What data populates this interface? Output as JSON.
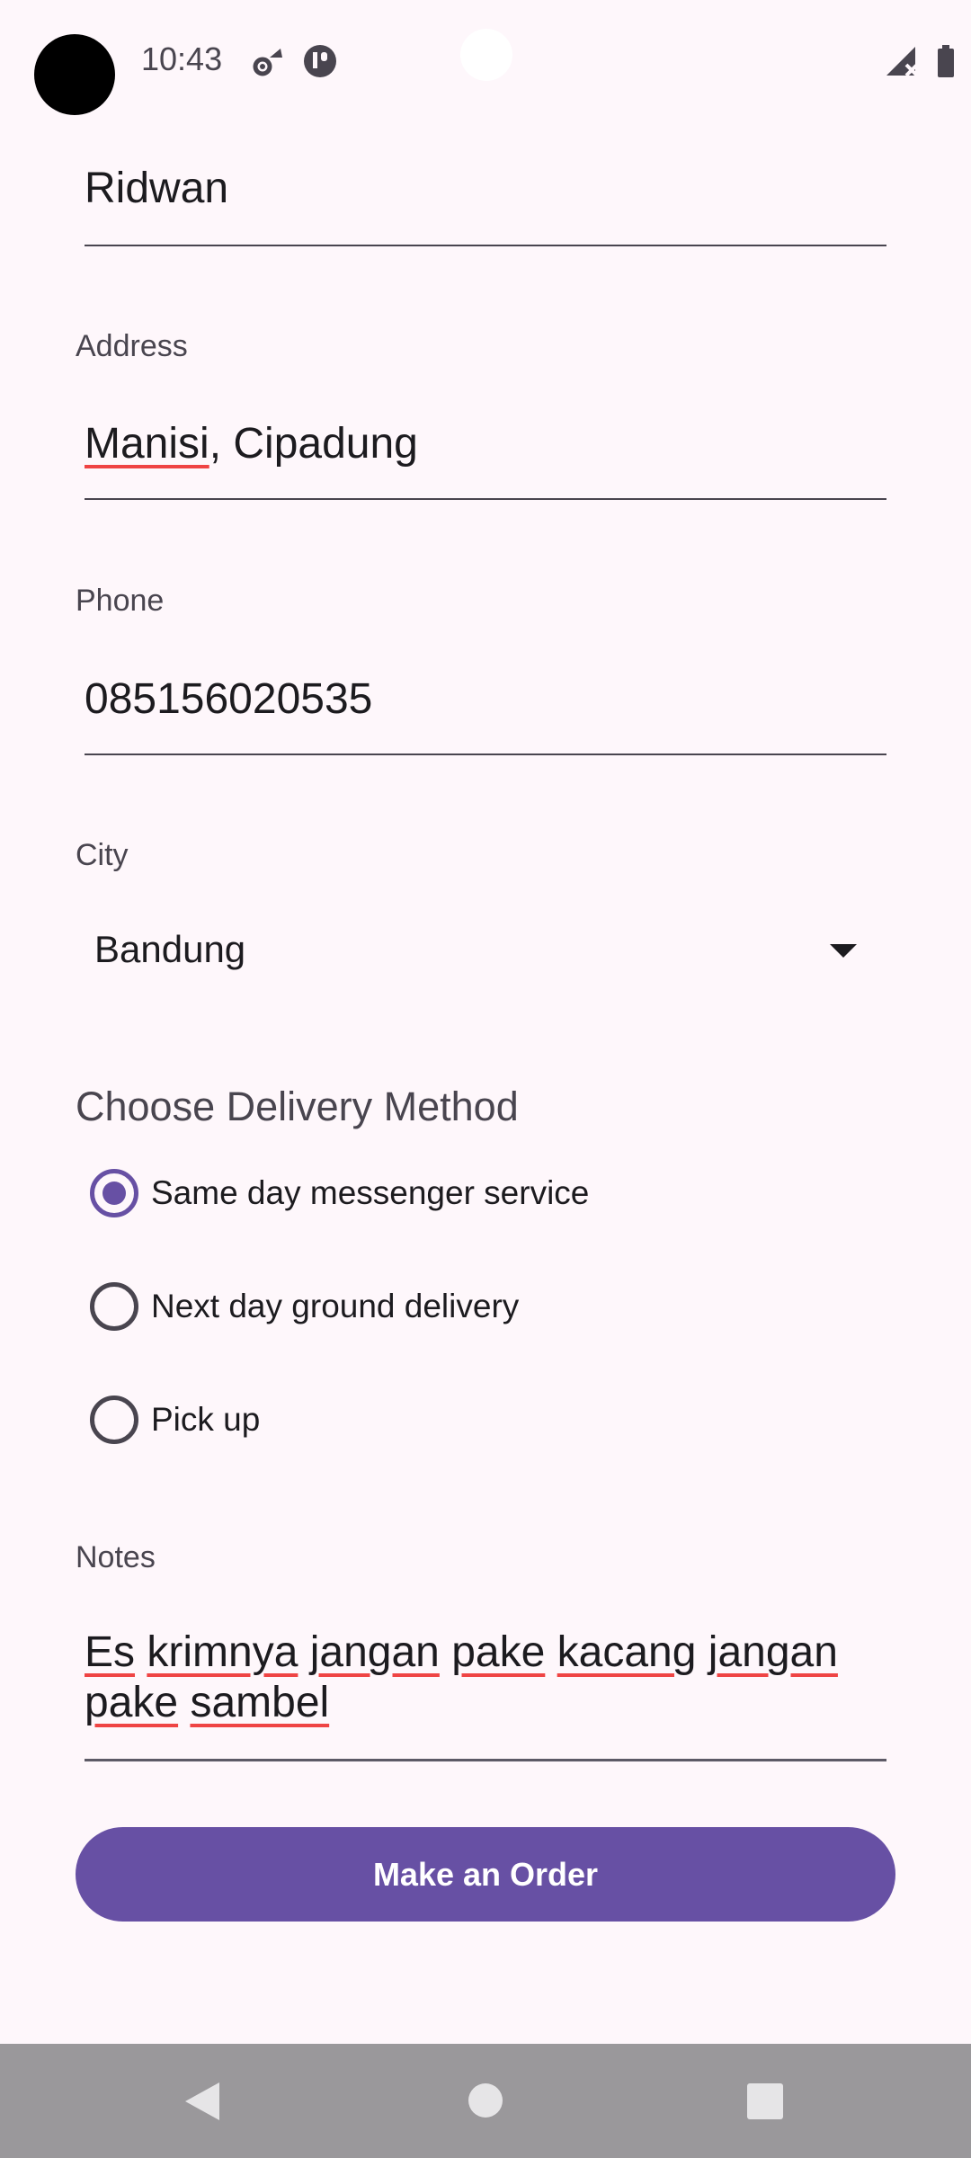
{
  "status_bar": {
    "time": "10:43",
    "icons": [
      "settings-wifi-icon",
      "app-notification-icon",
      "no-signal-icon",
      "battery-icon"
    ]
  },
  "form": {
    "name": {
      "value": "Ridwan"
    },
    "address": {
      "label": "Address",
      "value_part1": "Manisi",
      "value_part2": ", Cipadung"
    },
    "phone": {
      "label": "Phone",
      "value": "085156020535"
    },
    "city": {
      "label": "City",
      "selected": "Bandung"
    },
    "delivery": {
      "title": "Choose Delivery Method",
      "options": [
        {
          "label": "Same day messenger service",
          "selected": true
        },
        {
          "label": "Next day ground delivery",
          "selected": false
        },
        {
          "label": "Pick up",
          "selected": false
        }
      ]
    },
    "notes": {
      "label": "Notes",
      "words": [
        "Es",
        "krimnya",
        "jangan",
        "pake",
        "kacang",
        "jangan",
        "pake",
        "sambel"
      ]
    },
    "submit_label": "Make an Order"
  },
  "colors": {
    "accent": "#6750a4",
    "background": "#fef7fb",
    "spellcheck": "#ef4444",
    "nav_bar": "#9a989b"
  }
}
